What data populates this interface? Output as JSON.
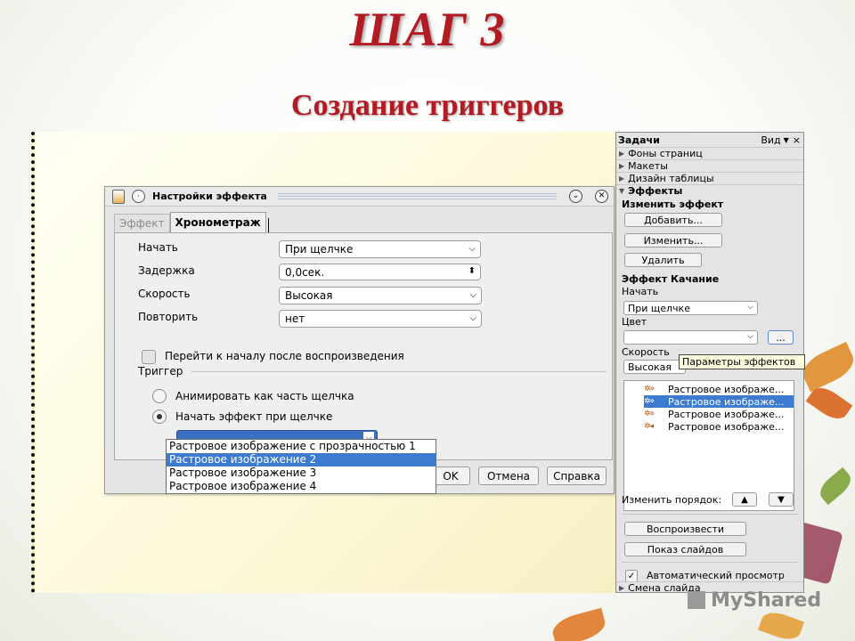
{
  "slide": {
    "step_title": "ШАГ 3",
    "subtitle": "Создание триггеров"
  },
  "dialog": {
    "title": "Настройки эффекта",
    "tabs": [
      {
        "label": "Эффект",
        "active": false
      },
      {
        "label": "Хронометраж",
        "active": true
      }
    ],
    "fields": [
      {
        "label": "Начать",
        "value": "При щелчке",
        "type": "select"
      },
      {
        "label": "Задержка",
        "value": "0,0сек.",
        "type": "spinner"
      },
      {
        "label": "Скорость",
        "value": "Высокая",
        "type": "select"
      },
      {
        "label": "Повторить",
        "value": "нет",
        "type": "select"
      }
    ],
    "rewind_checkbox": {
      "label": "Перейти к началу после воспроизведения",
      "checked": false
    },
    "trigger": {
      "group_label": "Триггер",
      "radio_animate": {
        "label": "Анимировать как часть щелчка",
        "selected": false
      },
      "radio_start": {
        "label": "Начать эффект при щелчке",
        "selected": true
      },
      "dropdown_items": [
        "Растровое изображение с прозрачностью 1",
        "Растровое изображение 2",
        "Растровое изображение 3",
        "Растровое изображение 4"
      ],
      "highlighted_index": 1
    },
    "buttons": {
      "ok": "OK",
      "cancel": "Отмена",
      "help": "Справка"
    }
  },
  "taskpane": {
    "title": "Задачи",
    "view_menu": "Вид",
    "close": "×",
    "sections": [
      "Фоны страниц",
      "Макеты",
      "Дизайн таблицы",
      "Эффекты"
    ],
    "change_effect_label": "Изменить эффект",
    "add_button": "Добавить...",
    "modify_button": "Изменить...",
    "delete_button": "Удалить",
    "effect_name": "Эффект Качание",
    "start_label": "Начать",
    "start_value": "При щелчке",
    "color_label": "Цвет",
    "color_value": "",
    "options_button": "...",
    "speed_label": "Скорость",
    "speed_value": "Высокая",
    "tooltip": "Параметры эффектов",
    "effects_list": [
      {
        "label": "Растровое изображе...",
        "selected": false
      },
      {
        "label": "Растровое изображе...",
        "selected": true
      },
      {
        "label": "Растровое изображе...",
        "selected": false
      },
      {
        "label": "Растровое изображе...",
        "selected": false
      }
    ],
    "reorder_label": "Изменить порядок:",
    "play_button": "Воспроизвести",
    "slideshow_button": "Показ слайдов",
    "auto_preview": {
      "label": "Автоматический просмотр",
      "checked": true
    },
    "bottom_section": "Смена слайда"
  },
  "watermark": "MyShared"
}
